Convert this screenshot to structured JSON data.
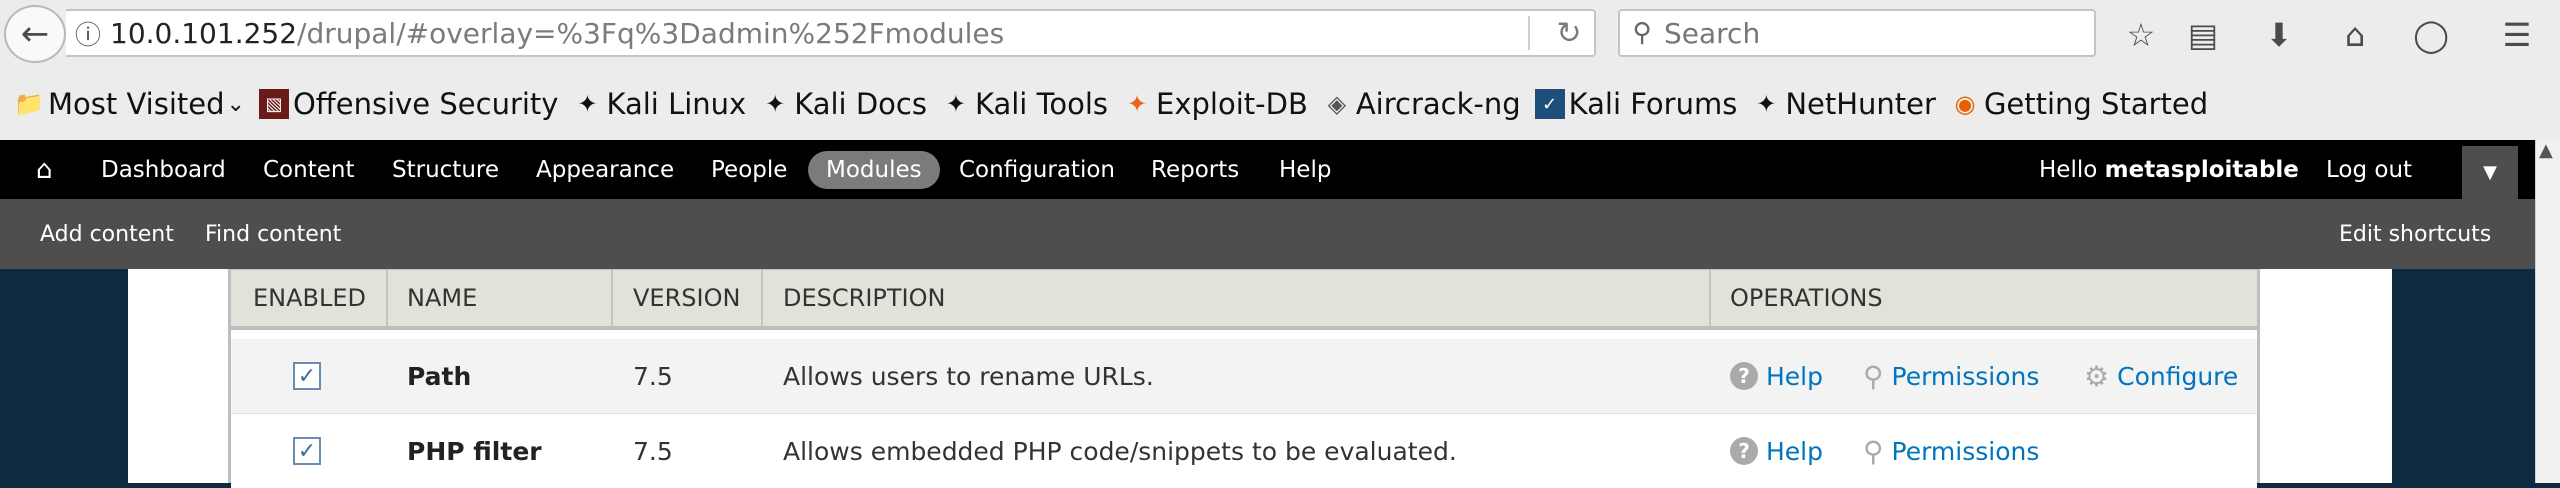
{
  "browser": {
    "url_host": "10.0.101.252",
    "url_path": "/drupal/#overlay=%3Fq%3Dadmin%252Fmodules",
    "search_placeholder": "Search"
  },
  "bookmarks": [
    {
      "label": "Most Visited",
      "icon": "chevron-down-icon"
    },
    {
      "label": "Offensive Security",
      "icon": "offsec-icon"
    },
    {
      "label": "Kali Linux",
      "icon": "kali-dragon-icon"
    },
    {
      "label": "Kali Docs",
      "icon": "kali-dragon-icon"
    },
    {
      "label": "Kali Tools",
      "icon": "kali-dragon-icon"
    },
    {
      "label": "Exploit-DB",
      "icon": "exploitdb-icon"
    },
    {
      "label": "Aircrack-ng",
      "icon": "aircrack-icon"
    },
    {
      "label": "Kali Forums",
      "icon": "kali-forums-icon"
    },
    {
      "label": "NetHunter",
      "icon": "kali-dragon-icon"
    },
    {
      "label": "Getting Started",
      "icon": "firefox-icon"
    }
  ],
  "admin_menu": {
    "items": [
      "Dashboard",
      "Content",
      "Structure",
      "Appearance",
      "People",
      "Modules",
      "Configuration",
      "Reports",
      "Help"
    ],
    "active": "Modules",
    "hello": "Hello",
    "username": "metasploitable",
    "logout": "Log out"
  },
  "shortcuts": {
    "items": [
      "Add content",
      "Find content"
    ],
    "edit": "Edit shortcuts"
  },
  "table": {
    "headers": [
      "ENABLED",
      "NAME",
      "VERSION",
      "DESCRIPTION",
      "OPERATIONS"
    ],
    "rows": [
      {
        "enabled": true,
        "name": "Path",
        "version": "7.5",
        "description": "Allows users to rename URLs.",
        "ops": [
          "Help",
          "Permissions",
          "Configure"
        ]
      },
      {
        "enabled": true,
        "name": "PHP filter",
        "version": "7.5",
        "description": "Allows embedded PHP code/snippets to be evaluated.",
        "ops": [
          "Help",
          "Permissions"
        ]
      }
    ]
  }
}
